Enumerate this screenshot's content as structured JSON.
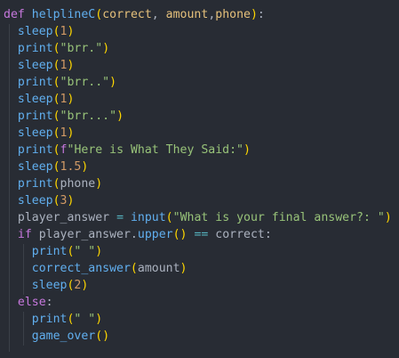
{
  "code": {
    "lines": [
      [
        {
          "t": "def",
          "c": "kw"
        },
        {
          "t": " ",
          "c": "var"
        },
        {
          "t": "helplineC",
          "c": "fn"
        },
        {
          "t": "(",
          "c": "paren1"
        },
        {
          "t": "correct",
          "c": "param"
        },
        {
          "t": ", ",
          "c": "punc"
        },
        {
          "t": "amount",
          "c": "param"
        },
        {
          "t": ",",
          "c": "punc"
        },
        {
          "t": "phone",
          "c": "param"
        },
        {
          "t": ")",
          "c": "paren1"
        },
        {
          "t": ":",
          "c": "punc"
        }
      ],
      [
        {
          "t": "  ",
          "c": "var"
        },
        {
          "t": "sleep",
          "c": "fn"
        },
        {
          "t": "(",
          "c": "paren1"
        },
        {
          "t": "1",
          "c": "num"
        },
        {
          "t": ")",
          "c": "paren1"
        }
      ],
      [
        {
          "t": "  ",
          "c": "var"
        },
        {
          "t": "print",
          "c": "fn"
        },
        {
          "t": "(",
          "c": "paren1"
        },
        {
          "t": "\"brr.\"",
          "c": "str"
        },
        {
          "t": ")",
          "c": "paren1"
        }
      ],
      [
        {
          "t": "  ",
          "c": "var"
        },
        {
          "t": "sleep",
          "c": "fn"
        },
        {
          "t": "(",
          "c": "paren1"
        },
        {
          "t": "1",
          "c": "num"
        },
        {
          "t": ")",
          "c": "paren1"
        }
      ],
      [
        {
          "t": "  ",
          "c": "var"
        },
        {
          "t": "print",
          "c": "fn"
        },
        {
          "t": "(",
          "c": "paren1"
        },
        {
          "t": "\"brr..\"",
          "c": "str"
        },
        {
          "t": ")",
          "c": "paren1"
        }
      ],
      [
        {
          "t": "  ",
          "c": "var"
        },
        {
          "t": "sleep",
          "c": "fn"
        },
        {
          "t": "(",
          "c": "paren1"
        },
        {
          "t": "1",
          "c": "num"
        },
        {
          "t": ")",
          "c": "paren1"
        }
      ],
      [
        {
          "t": "  ",
          "c": "var"
        },
        {
          "t": "print",
          "c": "fn"
        },
        {
          "t": "(",
          "c": "paren1"
        },
        {
          "t": "\"brr...\"",
          "c": "str"
        },
        {
          "t": ")",
          "c": "paren1"
        }
      ],
      [
        {
          "t": "  ",
          "c": "var"
        },
        {
          "t": "sleep",
          "c": "fn"
        },
        {
          "t": "(",
          "c": "paren1"
        },
        {
          "t": "1",
          "c": "num"
        },
        {
          "t": ")",
          "c": "paren1"
        }
      ],
      [
        {
          "t": "  ",
          "c": "var"
        },
        {
          "t": "print",
          "c": "fn"
        },
        {
          "t": "(",
          "c": "paren1"
        },
        {
          "t": "f",
          "c": "fprefix"
        },
        {
          "t": "\"Here is What They Said:\"",
          "c": "str"
        },
        {
          "t": ")",
          "c": "paren1"
        }
      ],
      [
        {
          "t": "  ",
          "c": "var"
        },
        {
          "t": "sleep",
          "c": "fn"
        },
        {
          "t": "(",
          "c": "paren1"
        },
        {
          "t": "1.5",
          "c": "num"
        },
        {
          "t": ")",
          "c": "paren1"
        }
      ],
      [
        {
          "t": "  ",
          "c": "var"
        },
        {
          "t": "print",
          "c": "fn"
        },
        {
          "t": "(",
          "c": "paren1"
        },
        {
          "t": "phone",
          "c": "var"
        },
        {
          "t": ")",
          "c": "paren1"
        }
      ],
      [
        {
          "t": "  ",
          "c": "var"
        },
        {
          "t": "sleep",
          "c": "fn"
        },
        {
          "t": "(",
          "c": "paren1"
        },
        {
          "t": "3",
          "c": "num"
        },
        {
          "t": ")",
          "c": "paren1"
        }
      ],
      [
        {
          "t": "  ",
          "c": "var"
        },
        {
          "t": "player_answer",
          "c": "var"
        },
        {
          "t": " ",
          "c": "var"
        },
        {
          "t": "=",
          "c": "op"
        },
        {
          "t": " ",
          "c": "var"
        },
        {
          "t": "input",
          "c": "fn"
        },
        {
          "t": "(",
          "c": "paren1"
        },
        {
          "t": "\"What is your final answer?: \"",
          "c": "str"
        },
        {
          "t": ")",
          "c": "paren1"
        }
      ],
      [
        {
          "t": "  ",
          "c": "var"
        },
        {
          "t": "if",
          "c": "kw"
        },
        {
          "t": " player_answer.",
          "c": "var"
        },
        {
          "t": "upper",
          "c": "fn"
        },
        {
          "t": "(",
          "c": "paren1"
        },
        {
          "t": ")",
          "c": "paren1"
        },
        {
          "t": " ",
          "c": "var"
        },
        {
          "t": "==",
          "c": "op"
        },
        {
          "t": " correct:",
          "c": "var"
        }
      ],
      [
        {
          "t": "    ",
          "c": "var"
        },
        {
          "t": "print",
          "c": "fn"
        },
        {
          "t": "(",
          "c": "paren1"
        },
        {
          "t": "\" \"",
          "c": "str"
        },
        {
          "t": ")",
          "c": "paren1"
        }
      ],
      [
        {
          "t": "    ",
          "c": "var"
        },
        {
          "t": "correct_answer",
          "c": "fn"
        },
        {
          "t": "(",
          "c": "paren1"
        },
        {
          "t": "amount",
          "c": "var"
        },
        {
          "t": ")",
          "c": "paren1"
        }
      ],
      [
        {
          "t": "    ",
          "c": "var"
        },
        {
          "t": "sleep",
          "c": "fn"
        },
        {
          "t": "(",
          "c": "paren1"
        },
        {
          "t": "2",
          "c": "num"
        },
        {
          "t": ")",
          "c": "paren1"
        }
      ],
      [
        {
          "t": "  ",
          "c": "var"
        },
        {
          "t": "else",
          "c": "kw"
        },
        {
          "t": ":",
          "c": "punc"
        }
      ],
      [
        {
          "t": "    ",
          "c": "var"
        },
        {
          "t": "print",
          "c": "fn"
        },
        {
          "t": "(",
          "c": "paren1"
        },
        {
          "t": "\" \"",
          "c": "str"
        },
        {
          "t": ")",
          "c": "paren1"
        }
      ],
      [
        {
          "t": "    ",
          "c": "var"
        },
        {
          "t": "game_over",
          "c": "fn"
        },
        {
          "t": "(",
          "c": "paren1"
        },
        {
          "t": ")",
          "c": "paren1"
        }
      ]
    ]
  },
  "colors": {
    "background": "#282c34",
    "keyword": "#c678dd",
    "function": "#61afef",
    "parameter": "#e5c07b",
    "number": "#d19a66",
    "string": "#98c379",
    "operator": "#56b6c2",
    "bracket": "#ffd700"
  }
}
